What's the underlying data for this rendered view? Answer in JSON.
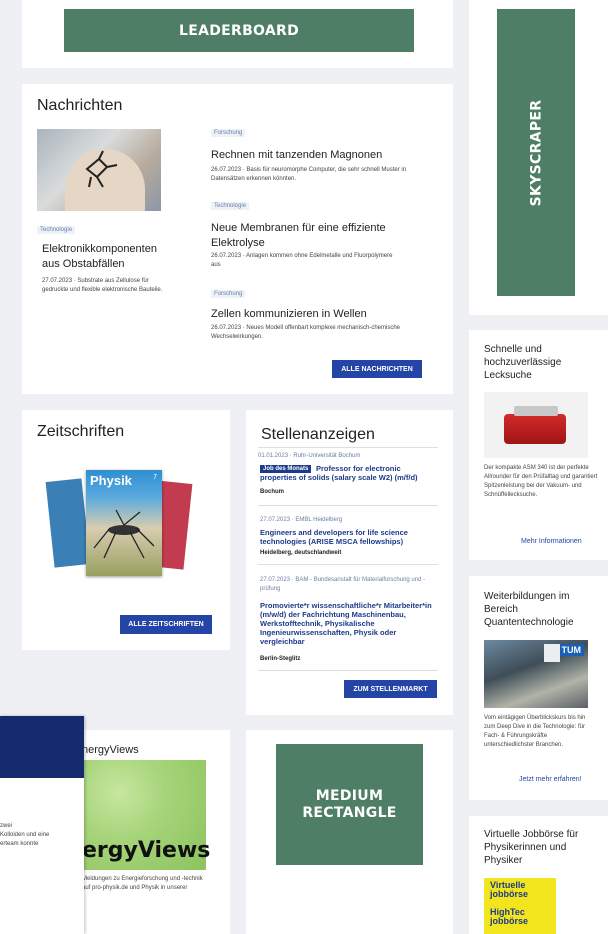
{
  "ads": {
    "leaderboard": "LEADERBOARD",
    "skyscraper": "SKYSCRAPER",
    "medium_rectangle": "MEDIUM RECTANGLE"
  },
  "news": {
    "heading": "Nachrichten",
    "featured": {
      "tag": "Technologie",
      "title": "Elektronikkomponenten aus Obstabfällen",
      "date_text": "27.07.2023 · Substrate aus Zellulose für gedruckte und flexible elektronische Bauteile."
    },
    "items": [
      {
        "tag": "Forschung",
        "title": "Rechnen mit tanzenden Magnonen",
        "text": "26.07.2023 · Basis für neuromorphe Computer, die sehr schnell Muster in Datensätzen erkennen könnten."
      },
      {
        "tag": "Technologie",
        "title": "Neue Membranen für eine effiziente Elektrolyse",
        "text": "26.07.2023 · Anlagen kommen ohne Edelmetalle und Fluorpolymere aus"
      },
      {
        "tag": "Forschung",
        "title": "Zellen kommunizieren in Wellen",
        "text": "26.07.2023 · Neues Modell offenbart komplexe mechanisch-chemische Wechselwirkungen."
      }
    ],
    "button": "ALLE NACHRICHTEN"
  },
  "journals": {
    "heading": "Zeitschriften",
    "cover_title": "Physik",
    "cover_number": "7",
    "button": "ALLE ZEITSCHRIFTEN"
  },
  "jobs": {
    "heading": "Stellenanzeigen",
    "items": [
      {
        "meta": "01.01.2023 · Ruhr-Universität Bochum",
        "badge": "Job des Monats",
        "title": "Professor for electronic properties of solids (salary scale W2) (m/f/d)",
        "location": "Bochum"
      },
      {
        "meta": "27.07.2023 · EMBL Heidelberg",
        "title": "Engineers and developers for life science technologies (ARISE MSCA fellowships)",
        "location": "Heidelberg, deutschlandweit"
      },
      {
        "meta": "27.07.2023 · BAM - Bundesanstalt für Materialforschung und -prüfung",
        "title": "Promovierte*r wissenschaftliche*r Mitarbeiter*in (m/w/d) der Fachrichtung Maschinenbau, Werkstofftechnik, Physikalische Ingenieurwissenschaften, Physik oder vergleichbar",
        "location": "Berlin-Steglitz"
      }
    ],
    "button": "ZUM STELLENMARKT"
  },
  "energy": {
    "heading": "nergyViews",
    "logo_text": "ergyViews",
    "text": "Meldungen zu Energieforschung und -technik auf pro-physik.de und Physik in unserer"
  },
  "popup": {
    "text_lines": [
      "zwei",
      "Kolloiden und eine",
      "erteam konnte"
    ]
  },
  "sidebar": {
    "leak": {
      "title": "Schnelle und hochzuverlässige Lecksuche",
      "text": "Der kompakte ASM 340 ist der perfekte Allrounder für den Prüfalltag und garantiert Spitzenleistung bei der Vakuum- und Schnüffellecksuche.",
      "link": "Mehr Informationen"
    },
    "quantum": {
      "title": "Weiterbildungen im Bereich Quantentechnologie",
      "logo": "TUM",
      "text": "Vom eintägigen Überblickskurs bis hin zum Deep Dive in die Technologie: für Fach- & Führungskräfte unterschiedlichster Branchen.",
      "link": "Jetzt mehr erfahren!"
    },
    "jobboerse": {
      "title": "Virtuelle Jobbörse für Physikerinnen und Physiker",
      "logo1": "Virtuelle jobbörse",
      "logo2": "HighTec jobbörse"
    }
  }
}
